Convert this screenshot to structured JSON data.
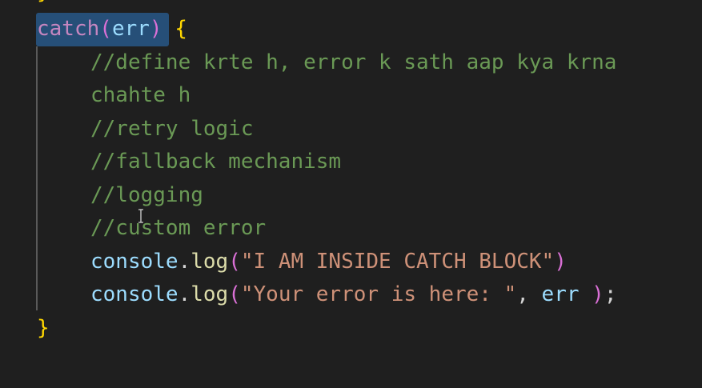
{
  "code": {
    "top_brace": "}",
    "catch_kw": "catch",
    "catch_open_paren": "(",
    "catch_param": "err",
    "catch_close_paren": ")",
    "catch_open_brace": "{",
    "comment_1a": "//define krte h, error k sath aap kya krna",
    "comment_1b": "chahte h",
    "comment_2": "//retry logic",
    "comment_3": "//fallback mechanism",
    "comment_4": "//logging",
    "comment_5": "//custom error",
    "log1_obj": "console",
    "log1_dot": ".",
    "log1_fn": "log",
    "log1_open": "(",
    "log1_str": "\"I AM INSIDE CATCH BLOCK\"",
    "log1_close": ")",
    "log2_obj": "console",
    "log2_dot": ".",
    "log2_fn": "log",
    "log2_open": "(",
    "log2_str": "\"Your error is here: \"",
    "log2_comma": ", ",
    "log2_arg": "err",
    "log2_space": " ",
    "log2_close": ")",
    "log2_semi": ";",
    "closing_brace": "}"
  },
  "colors": {
    "background": "#1f1f1f",
    "keyword": "#c586c0",
    "comment": "#6a9955",
    "string": "#ce9178",
    "identifier": "#9cdcfe",
    "function": "#dcdcaa",
    "bracket": "#ffd700",
    "selection": "#264f78"
  },
  "cursor_icon": "text-cursor-icon"
}
